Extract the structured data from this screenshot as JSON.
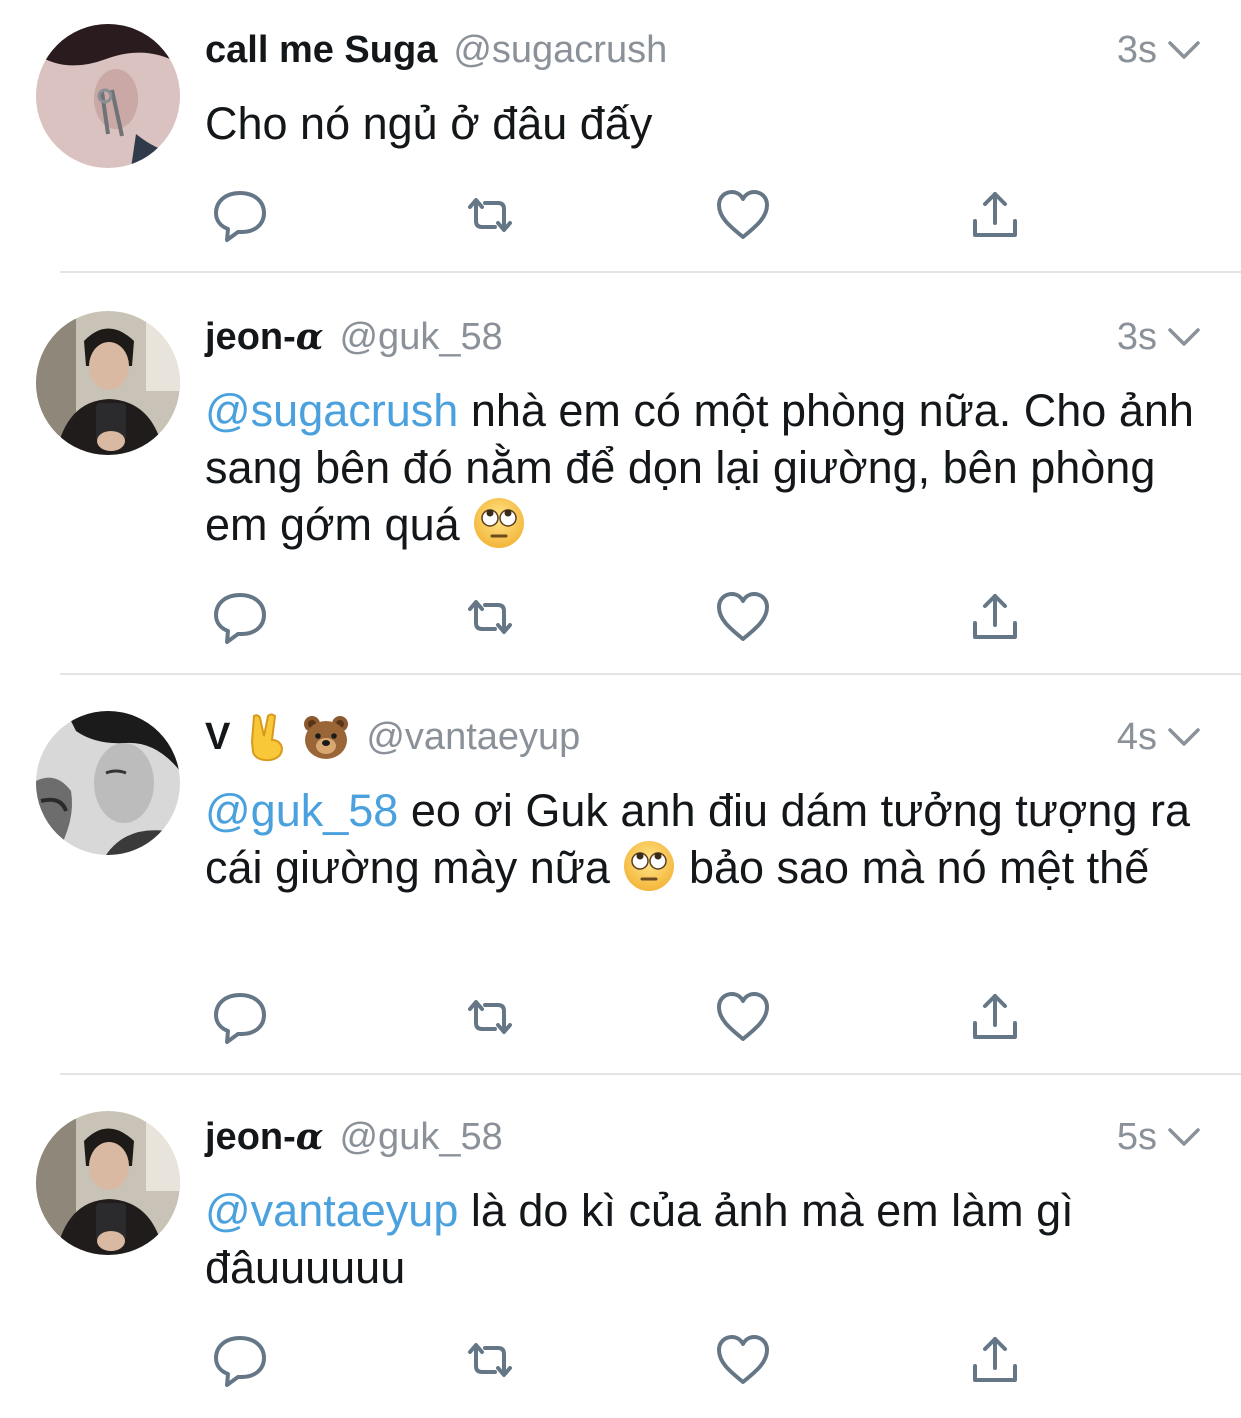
{
  "tweets": [
    {
      "name": "call me Suga",
      "name_suffix": "",
      "handle": "@sugacrush",
      "time": "3s",
      "mention": "",
      "text": "Cho nó ngủ ở đâu đấy",
      "text_after_emoji": ""
    },
    {
      "name": "jeon-",
      "name_suffix": "α",
      "handle": "@guk_58",
      "time": "3s",
      "mention": "@sugacrush",
      "text": " nhà em có một phòng nữa. Cho ảnh sang bên đó nằm để dọn lại giường, bên phòng em gớm quá ",
      "text_after_emoji": ""
    },
    {
      "name": "V",
      "name_suffix": "",
      "handle": "@vantaeyup",
      "time": "4s",
      "mention": "@guk_58",
      "text": " eo ơi Guk anh điu dám tưởng tượng ra cái giường mày nữa ",
      "text_after_emoji": " bảo sao mà nó mệt thế"
    },
    {
      "name": "jeon-",
      "name_suffix": "α",
      "handle": "@guk_58",
      "time": "5s",
      "mention": "@vantaeyup",
      "text": " là do kì của ảnh mà em làm gì đâuuuuuu",
      "text_after_emoji": ""
    }
  ],
  "icons": {
    "reply": "reply-icon",
    "retweet": "retweet-icon",
    "like": "heart-icon",
    "share": "share-icon",
    "more": "chevron-down-icon",
    "emoji_eyeroll": "eye-roll-emoji-icon",
    "emoji_victory": "victory-hand-emoji-icon",
    "emoji_bear": "bear-emoji-icon"
  },
  "colors": {
    "mention": "#4aa1de",
    "secondary": "#8a9199",
    "icon": "#657786",
    "divider": "#e2e5e8"
  }
}
